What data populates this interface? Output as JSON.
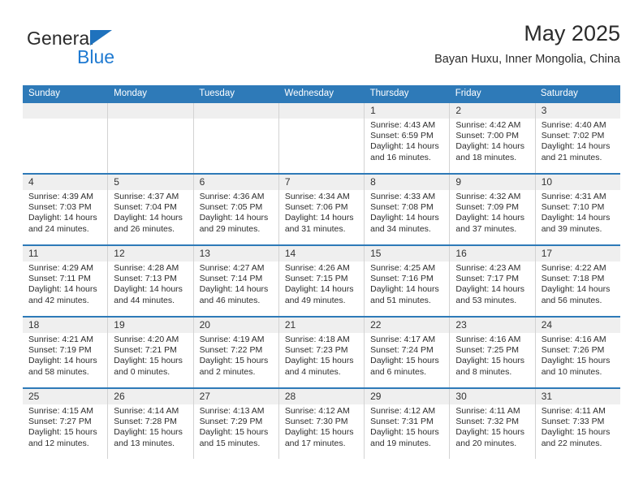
{
  "brand": {
    "name_top": "General",
    "name_bottom": "Blue",
    "accent_color": "#1f7ad1",
    "header_color": "#2e7ab8"
  },
  "header": {
    "title": "May 2025",
    "subtitle": "Bayan Huxu, Inner Mongolia, China"
  },
  "weekdays": [
    "Sunday",
    "Monday",
    "Tuesday",
    "Wednesday",
    "Thursday",
    "Friday",
    "Saturday"
  ],
  "weeks": [
    [
      {
        "day": "",
        "sunrise": "",
        "sunset": "",
        "daylight_line1": "",
        "daylight_line2": ""
      },
      {
        "day": "",
        "sunrise": "",
        "sunset": "",
        "daylight_line1": "",
        "daylight_line2": ""
      },
      {
        "day": "",
        "sunrise": "",
        "sunset": "",
        "daylight_line1": "",
        "daylight_line2": ""
      },
      {
        "day": "",
        "sunrise": "",
        "sunset": "",
        "daylight_line1": "",
        "daylight_line2": ""
      },
      {
        "day": "1",
        "sunrise": "Sunrise: 4:43 AM",
        "sunset": "Sunset: 6:59 PM",
        "daylight_line1": "Daylight: 14 hours",
        "daylight_line2": "and 16 minutes."
      },
      {
        "day": "2",
        "sunrise": "Sunrise: 4:42 AM",
        "sunset": "Sunset: 7:00 PM",
        "daylight_line1": "Daylight: 14 hours",
        "daylight_line2": "and 18 minutes."
      },
      {
        "day": "3",
        "sunrise": "Sunrise: 4:40 AM",
        "sunset": "Sunset: 7:02 PM",
        "daylight_line1": "Daylight: 14 hours",
        "daylight_line2": "and 21 minutes."
      }
    ],
    [
      {
        "day": "4",
        "sunrise": "Sunrise: 4:39 AM",
        "sunset": "Sunset: 7:03 PM",
        "daylight_line1": "Daylight: 14 hours",
        "daylight_line2": "and 24 minutes."
      },
      {
        "day": "5",
        "sunrise": "Sunrise: 4:37 AM",
        "sunset": "Sunset: 7:04 PM",
        "daylight_line1": "Daylight: 14 hours",
        "daylight_line2": "and 26 minutes."
      },
      {
        "day": "6",
        "sunrise": "Sunrise: 4:36 AM",
        "sunset": "Sunset: 7:05 PM",
        "daylight_line1": "Daylight: 14 hours",
        "daylight_line2": "and 29 minutes."
      },
      {
        "day": "7",
        "sunrise": "Sunrise: 4:34 AM",
        "sunset": "Sunset: 7:06 PM",
        "daylight_line1": "Daylight: 14 hours",
        "daylight_line2": "and 31 minutes."
      },
      {
        "day": "8",
        "sunrise": "Sunrise: 4:33 AM",
        "sunset": "Sunset: 7:08 PM",
        "daylight_line1": "Daylight: 14 hours",
        "daylight_line2": "and 34 minutes."
      },
      {
        "day": "9",
        "sunrise": "Sunrise: 4:32 AM",
        "sunset": "Sunset: 7:09 PM",
        "daylight_line1": "Daylight: 14 hours",
        "daylight_line2": "and 37 minutes."
      },
      {
        "day": "10",
        "sunrise": "Sunrise: 4:31 AM",
        "sunset": "Sunset: 7:10 PM",
        "daylight_line1": "Daylight: 14 hours",
        "daylight_line2": "and 39 minutes."
      }
    ],
    [
      {
        "day": "11",
        "sunrise": "Sunrise: 4:29 AM",
        "sunset": "Sunset: 7:11 PM",
        "daylight_line1": "Daylight: 14 hours",
        "daylight_line2": "and 42 minutes."
      },
      {
        "day": "12",
        "sunrise": "Sunrise: 4:28 AM",
        "sunset": "Sunset: 7:13 PM",
        "daylight_line1": "Daylight: 14 hours",
        "daylight_line2": "and 44 minutes."
      },
      {
        "day": "13",
        "sunrise": "Sunrise: 4:27 AM",
        "sunset": "Sunset: 7:14 PM",
        "daylight_line1": "Daylight: 14 hours",
        "daylight_line2": "and 46 minutes."
      },
      {
        "day": "14",
        "sunrise": "Sunrise: 4:26 AM",
        "sunset": "Sunset: 7:15 PM",
        "daylight_line1": "Daylight: 14 hours",
        "daylight_line2": "and 49 minutes."
      },
      {
        "day": "15",
        "sunrise": "Sunrise: 4:25 AM",
        "sunset": "Sunset: 7:16 PM",
        "daylight_line1": "Daylight: 14 hours",
        "daylight_line2": "and 51 minutes."
      },
      {
        "day": "16",
        "sunrise": "Sunrise: 4:23 AM",
        "sunset": "Sunset: 7:17 PM",
        "daylight_line1": "Daylight: 14 hours",
        "daylight_line2": "and 53 minutes."
      },
      {
        "day": "17",
        "sunrise": "Sunrise: 4:22 AM",
        "sunset": "Sunset: 7:18 PM",
        "daylight_line1": "Daylight: 14 hours",
        "daylight_line2": "and 56 minutes."
      }
    ],
    [
      {
        "day": "18",
        "sunrise": "Sunrise: 4:21 AM",
        "sunset": "Sunset: 7:19 PM",
        "daylight_line1": "Daylight: 14 hours",
        "daylight_line2": "and 58 minutes."
      },
      {
        "day": "19",
        "sunrise": "Sunrise: 4:20 AM",
        "sunset": "Sunset: 7:21 PM",
        "daylight_line1": "Daylight: 15 hours",
        "daylight_line2": "and 0 minutes."
      },
      {
        "day": "20",
        "sunrise": "Sunrise: 4:19 AM",
        "sunset": "Sunset: 7:22 PM",
        "daylight_line1": "Daylight: 15 hours",
        "daylight_line2": "and 2 minutes."
      },
      {
        "day": "21",
        "sunrise": "Sunrise: 4:18 AM",
        "sunset": "Sunset: 7:23 PM",
        "daylight_line1": "Daylight: 15 hours",
        "daylight_line2": "and 4 minutes."
      },
      {
        "day": "22",
        "sunrise": "Sunrise: 4:17 AM",
        "sunset": "Sunset: 7:24 PM",
        "daylight_line1": "Daylight: 15 hours",
        "daylight_line2": "and 6 minutes."
      },
      {
        "day": "23",
        "sunrise": "Sunrise: 4:16 AM",
        "sunset": "Sunset: 7:25 PM",
        "daylight_line1": "Daylight: 15 hours",
        "daylight_line2": "and 8 minutes."
      },
      {
        "day": "24",
        "sunrise": "Sunrise: 4:16 AM",
        "sunset": "Sunset: 7:26 PM",
        "daylight_line1": "Daylight: 15 hours",
        "daylight_line2": "and 10 minutes."
      }
    ],
    [
      {
        "day": "25",
        "sunrise": "Sunrise: 4:15 AM",
        "sunset": "Sunset: 7:27 PM",
        "daylight_line1": "Daylight: 15 hours",
        "daylight_line2": "and 12 minutes."
      },
      {
        "day": "26",
        "sunrise": "Sunrise: 4:14 AM",
        "sunset": "Sunset: 7:28 PM",
        "daylight_line1": "Daylight: 15 hours",
        "daylight_line2": "and 13 minutes."
      },
      {
        "day": "27",
        "sunrise": "Sunrise: 4:13 AM",
        "sunset": "Sunset: 7:29 PM",
        "daylight_line1": "Daylight: 15 hours",
        "daylight_line2": "and 15 minutes."
      },
      {
        "day": "28",
        "sunrise": "Sunrise: 4:12 AM",
        "sunset": "Sunset: 7:30 PM",
        "daylight_line1": "Daylight: 15 hours",
        "daylight_line2": "and 17 minutes."
      },
      {
        "day": "29",
        "sunrise": "Sunrise: 4:12 AM",
        "sunset": "Sunset: 7:31 PM",
        "daylight_line1": "Daylight: 15 hours",
        "daylight_line2": "and 19 minutes."
      },
      {
        "day": "30",
        "sunrise": "Sunrise: 4:11 AM",
        "sunset": "Sunset: 7:32 PM",
        "daylight_line1": "Daylight: 15 hours",
        "daylight_line2": "and 20 minutes."
      },
      {
        "day": "31",
        "sunrise": "Sunrise: 4:11 AM",
        "sunset": "Sunset: 7:33 PM",
        "daylight_line1": "Daylight: 15 hours",
        "daylight_line2": "and 22 minutes."
      }
    ]
  ]
}
